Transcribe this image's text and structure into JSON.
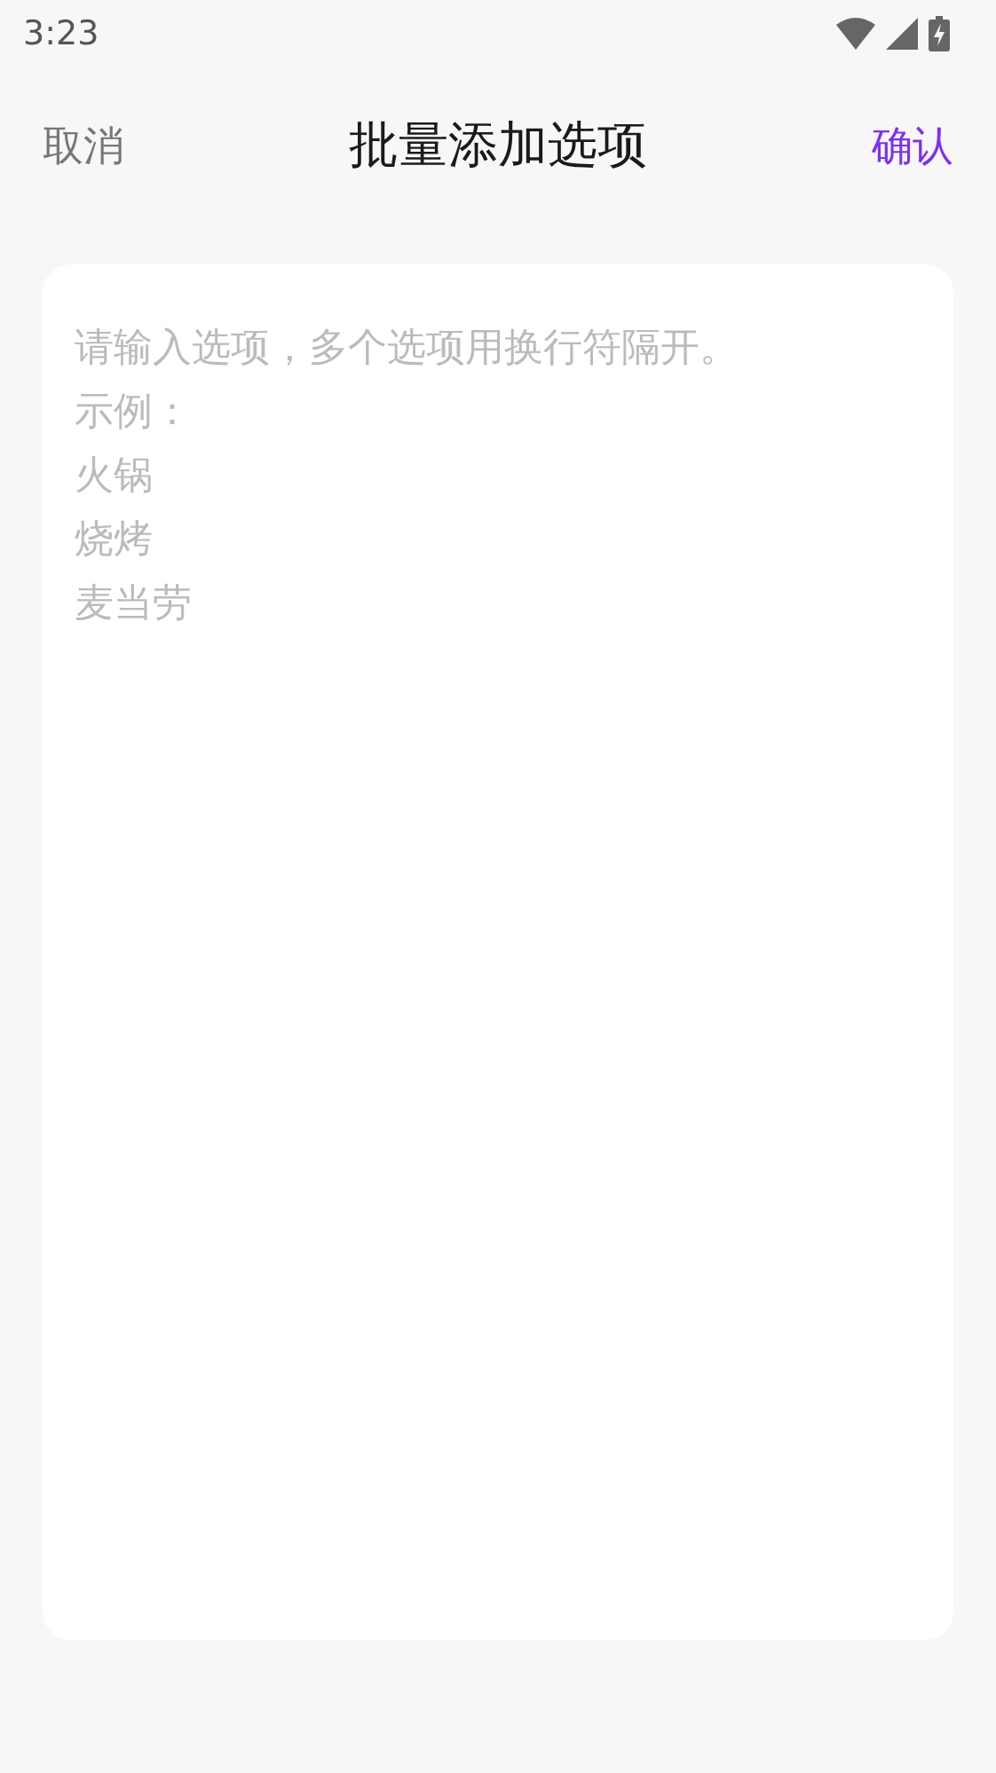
{
  "status_bar": {
    "time": "3:23"
  },
  "header": {
    "cancel": "取消",
    "title": "批量添加选项",
    "confirm": "确认"
  },
  "input": {
    "placeholder": [
      "请输入选项，多个选项用换行符隔开。",
      "示例：",
      "火锅",
      "烧烤",
      "麦当劳"
    ]
  }
}
